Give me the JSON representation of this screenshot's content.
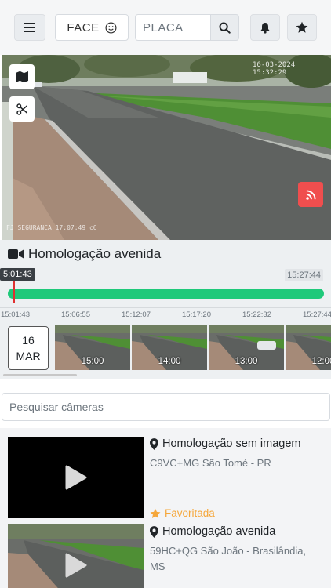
{
  "header": {
    "face_label": "FACE",
    "plate_placeholder": "PLACA"
  },
  "video": {
    "overlay_timestamp": "16-03-2024 15:32:29",
    "overlay_camera": "FJ SEGURANCA 17:07:49 c6"
  },
  "camera": {
    "title": "Homologação avenida"
  },
  "timeline": {
    "start_time": "5:01:43",
    "end_time": "15:27:44",
    "ticks": [
      "15:01:43",
      "15:06:55",
      "15:12:07",
      "15:17:20",
      "15:22:32",
      "15:27:44"
    ],
    "date_day": "16",
    "date_month": "MAR",
    "thumbnails": [
      "15:00",
      "14:00",
      "13:00",
      "12:00"
    ]
  },
  "search": {
    "placeholder": "Pesquisar câmeras"
  },
  "camera_list": [
    {
      "name": "Homologação sem imagem",
      "address": "C9VC+MG São Tomé - PR",
      "favorite_label": "Favoritada"
    },
    {
      "name": "Homologação avenida",
      "address": "59HC+QG São João - Brasilândia, MS"
    }
  ],
  "colors": {
    "timeline_bar": "#1fc97a",
    "marker": "#e03131",
    "rss_button": "#f04e4e",
    "favorite": "#f5a73b"
  }
}
